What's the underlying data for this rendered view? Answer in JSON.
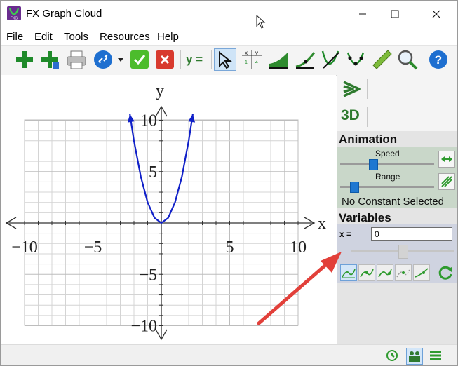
{
  "window": {
    "title": "FX Graph Cloud",
    "icon": "fx-graph-app-icon",
    "controls": [
      "minimize-icon",
      "maximize-icon",
      "close-icon"
    ]
  },
  "menu": {
    "items": [
      "File",
      "Edit",
      "Tools",
      "Resources",
      "Help"
    ]
  },
  "toolbar": {
    "equation_button_label": "y =",
    "icons": [
      "add-icon",
      "add-alt-icon",
      "print-icon",
      "link-icon",
      "dropdown-arrow-icon",
      "check-icon",
      "delete-icon",
      "equation-icon",
      "select-cursor-icon",
      "table-of-values-icon",
      "area-icon",
      "tangent-icon",
      "intersection-icon",
      "points-icon",
      "ruler-icon",
      "zoom-icon",
      "help-icon"
    ],
    "colors": {
      "green": "#2e9a2e",
      "red": "#d83a2e",
      "blue": "#1e6fd0"
    }
  },
  "graph": {
    "y_axis_label": "y",
    "x_axis_label": "x",
    "x_ticks": [
      "−10",
      "−5",
      "5",
      "10"
    ],
    "y_ticks": [
      "10",
      "5",
      "−5",
      "−10"
    ],
    "curve_color": "#1020c8"
  },
  "chart_data": {
    "type": "line",
    "series": [
      {
        "x": [
          -2.3,
          -2,
          -1.5,
          -1,
          -0.5,
          0,
          0.5,
          1,
          1.5,
          2,
          2.3
        ],
        "y": [
          10.58,
          8,
          4.5,
          2,
          0.5,
          0,
          0.5,
          2,
          4.5,
          8,
          10.58
        ]
      }
    ],
    "xlim": [
      -10,
      10
    ],
    "ylim": [
      -10,
      10
    ],
    "grid": true,
    "xlabel": "x",
    "ylabel": "y",
    "x_tick_values": [
      -10,
      -5,
      5,
      10
    ],
    "y_tick_values": [
      10,
      5,
      -5,
      -10
    ]
  },
  "side_panel": {
    "nav_icon": "next-chevron-icon",
    "view_3d_label": "3D",
    "animation": {
      "title": "Animation",
      "speed_label": "Speed",
      "speed_level": 0.34,
      "range_label": "Range",
      "range_level": 0.14,
      "no_constant_text": "No Constant Selected"
    },
    "variables": {
      "title": "Variables",
      "x_label": "x =",
      "x_value": "0",
      "slider_level": 0.5
    },
    "mode_icons": [
      "curve-mode-icon",
      "curve-mode-2-icon",
      "curve-mode-3-icon",
      "curve-mode-4-icon",
      "curve-mode-5-icon",
      "refresh-icon"
    ]
  },
  "statusbar": {
    "icons": [
      "history-icon",
      "users-icon",
      "list-icon"
    ]
  },
  "annotation": {
    "arrow_color": "#e2403a"
  }
}
